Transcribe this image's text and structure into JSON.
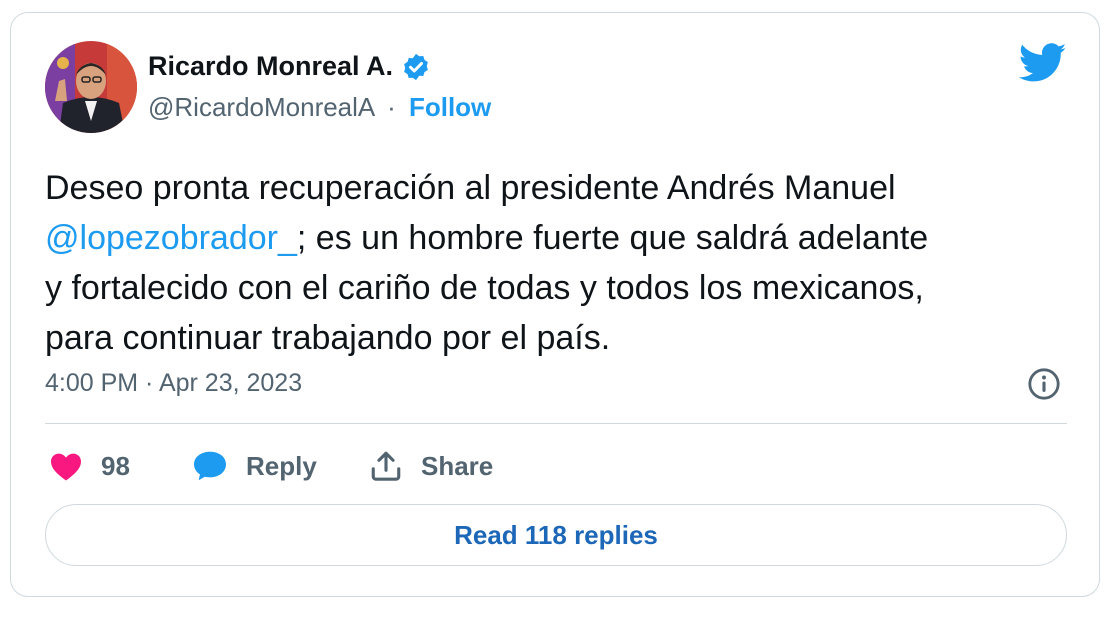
{
  "author": {
    "display_name": "Ricardo Monreal A.",
    "handle": "@RicardoMonrealA",
    "separator": "·",
    "follow_label": "Follow",
    "verified": true
  },
  "tweet": {
    "text_line1": "Deseo pronta recuperación al presidente Andrés Manuel",
    "mention": "@lopezobrador_",
    "text_line2_rest": "; es un hombre fuerte que saldrá adelante",
    "text_line3": "y fortalecido con el cariño de todas y todos los mexicanos,",
    "text_line4": "para continuar trabajando por el país.",
    "timestamp": "4:00 PM · Apr 23, 2023"
  },
  "actions": {
    "like_count": "98",
    "reply_label": "Reply",
    "share_label": "Share"
  },
  "read_replies_label": "Read 118 replies",
  "icons": {
    "brand": "twitter-bird-icon",
    "verified": "verified-badge-icon",
    "info": "info-icon",
    "like": "heart-icon",
    "reply": "speech-bubble-icon",
    "share": "share-upload-icon"
  },
  "colors": {
    "brand_blue": "#1d9bf0",
    "heart_pink": "#f91880",
    "text_primary": "#0f1419",
    "text_secondary": "#536471",
    "border": "#cfd9de"
  }
}
